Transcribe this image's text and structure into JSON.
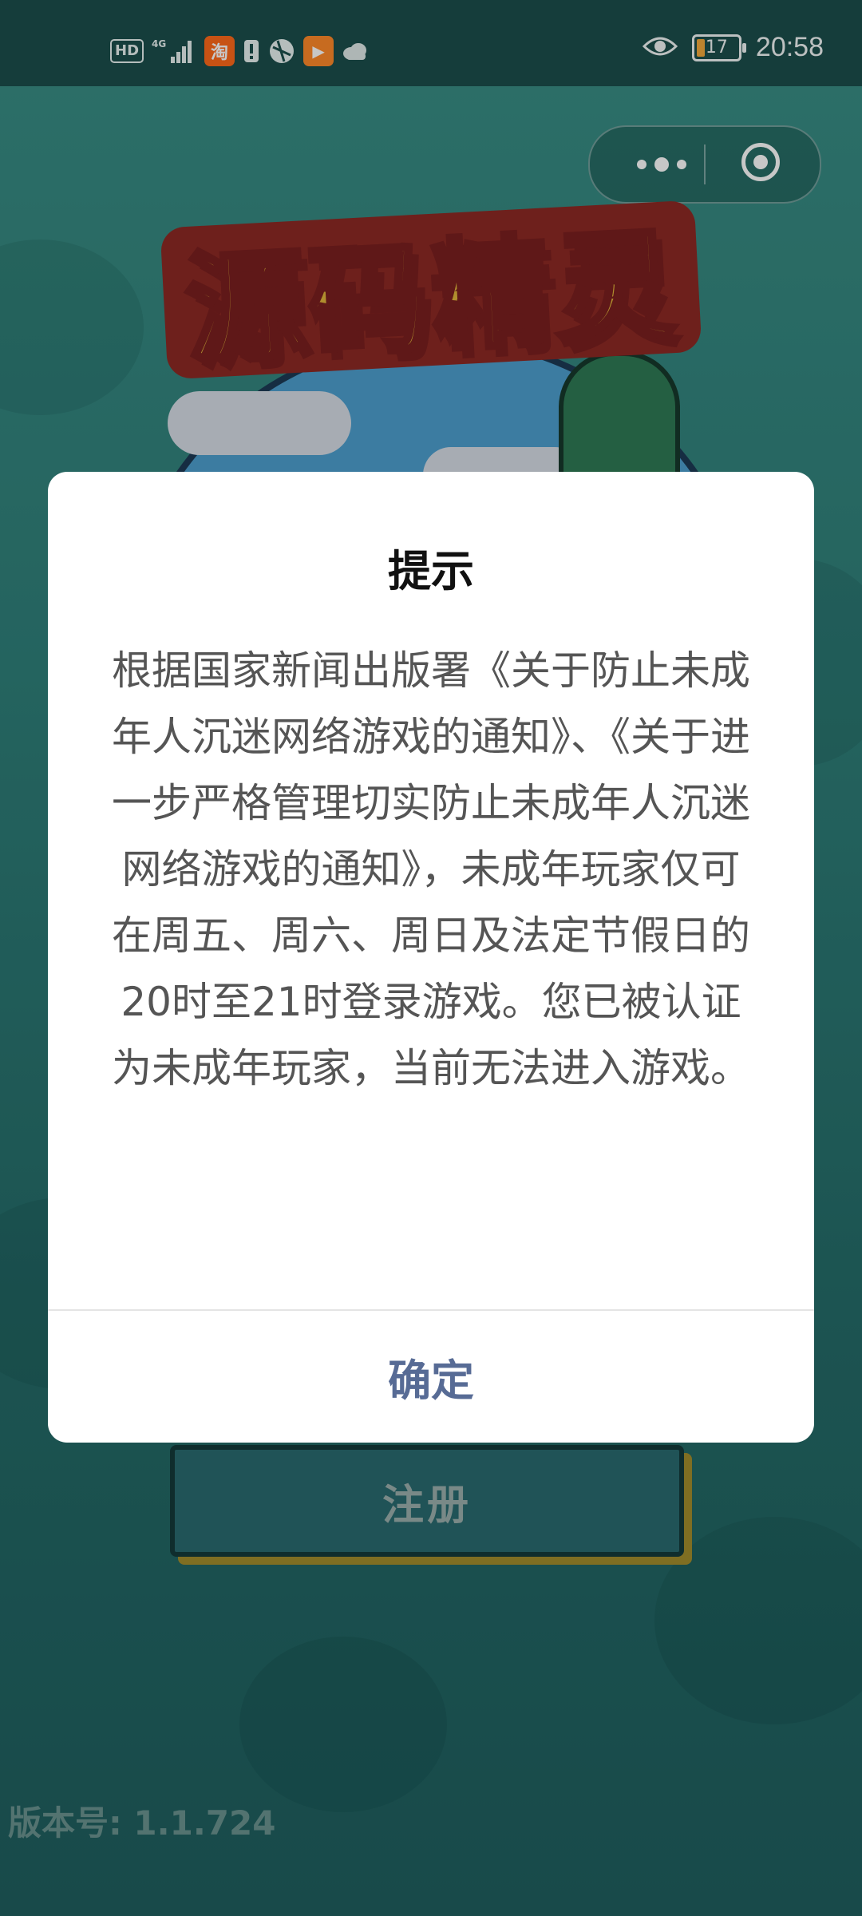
{
  "status_bar": {
    "hd": "HD",
    "network": "4G",
    "taobao": "淘",
    "time": "20:58",
    "battery_level": "17"
  },
  "capsule": {
    "more_icon": "more-dots-icon",
    "close_icon": "target-close-icon"
  },
  "game": {
    "logo_text": "源码精灵",
    "register_label": "注册",
    "version": "版本号: 1.1.724"
  },
  "dialog": {
    "title": "提示",
    "message": "根据国家新闻出版署《关于防止未成年人沉迷网络游戏的通知》、《关于进一步严格管理切实防止未成年人沉迷网络游戏的通知》，未成年玩家仅可在周五、周六、周日及法定节假日的20时至21时登录游戏。您已被认证为未成年玩家，当前无法进入游戏。",
    "confirm_label": "确定",
    "confirm_color": "#576b95"
  }
}
